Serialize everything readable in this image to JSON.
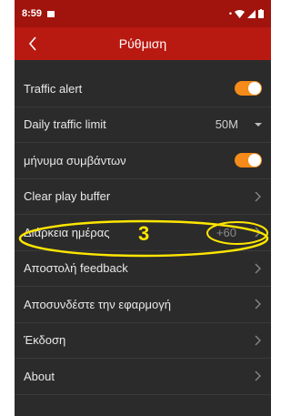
{
  "status": {
    "time": "8:59"
  },
  "header": {
    "title": "Ρύθμιση"
  },
  "rows": [
    {
      "label": "Traffic alert",
      "control": "toggle",
      "on": true
    },
    {
      "label": "Daily traffic limit",
      "value": "50M",
      "control": "dropdown"
    },
    {
      "label": "μήνυμα συμβάντων",
      "control": "toggle",
      "on": true
    },
    {
      "label": "Clear play buffer",
      "control": "chevron"
    },
    {
      "label": "Διάρκεια ημέρας",
      "value": "+60",
      "control": "chevron"
    },
    {
      "label": "Αποστολή feedback",
      "control": "chevron"
    },
    {
      "label": "Αποσυνδέστε την εφαρμογή",
      "control": "chevron"
    },
    {
      "label": "Έκδοση",
      "control": "chevron"
    },
    {
      "label": "About",
      "control": "chevron"
    }
  ],
  "annotation": {
    "number": "3",
    "color": "#ffe600"
  },
  "colors": {
    "statusbar": "#a0140d",
    "titlebar": "#b81a12",
    "toggle_on": "#f48b1a",
    "background": "#2b2b2b"
  }
}
